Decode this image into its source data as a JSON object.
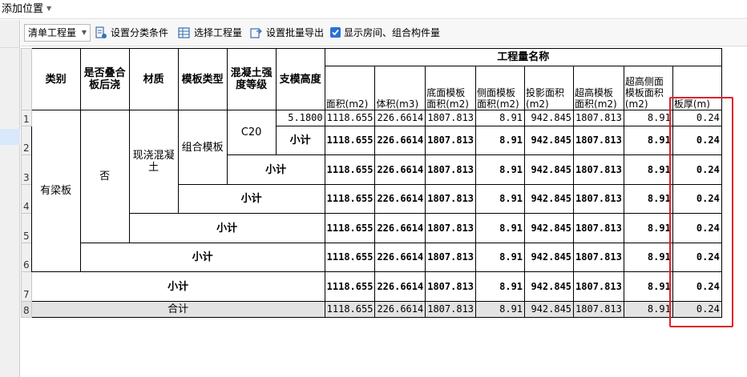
{
  "topbar": {
    "label": "添加位置"
  },
  "toolbar": {
    "dropdown": "清单工程量",
    "btn1": "设置分类条件",
    "btn2": "选择工程量",
    "btn3": "设置批量导出",
    "checkbox_label": "显示房间、组合构件量",
    "checkbox_checked": true
  },
  "table": {
    "headers": {
      "c1": "类别",
      "c2": "是否叠合板后浇",
      "c3": "材质",
      "c4": "模板类型",
      "c5": "混凝土强度等级",
      "c6": "支模高度",
      "group": "工程量名称",
      "q1": "面积(m2)",
      "q2": "体积(m3)",
      "q3": "底面模板面积(m2)",
      "q4": "侧面模板面积(m2)",
      "q5": "投影面积(m2)",
      "q6": "超高模板面积(m2)",
      "q7": "超高侧面模板面积(m2)",
      "q8": "板厚(m)"
    },
    "row_numbers": [
      "1",
      "2",
      "3",
      "4",
      "5",
      "6",
      "7",
      "8"
    ],
    "cells": {
      "category": "有梁板",
      "is_composite": "否",
      "material": "现浇混凝土",
      "formwork": "组合模板",
      "concrete": "C20",
      "height": "5.1800",
      "subtotal": "小计",
      "total": "合计"
    },
    "values": {
      "area": "1118.655",
      "volume": "226.6614",
      "bottom": "1807.813",
      "side": "8.91",
      "proj": "942.845",
      "high": "1807.813",
      "high_side": "8.91",
      "thick": "0.24"
    },
    "values_wrapped": {
      "area": "1118.655",
      "volume": "226.6614",
      "bottom": "1807.813",
      "high": "1807.813"
    }
  },
  "highlight": {
    "color": "#e0202a"
  }
}
